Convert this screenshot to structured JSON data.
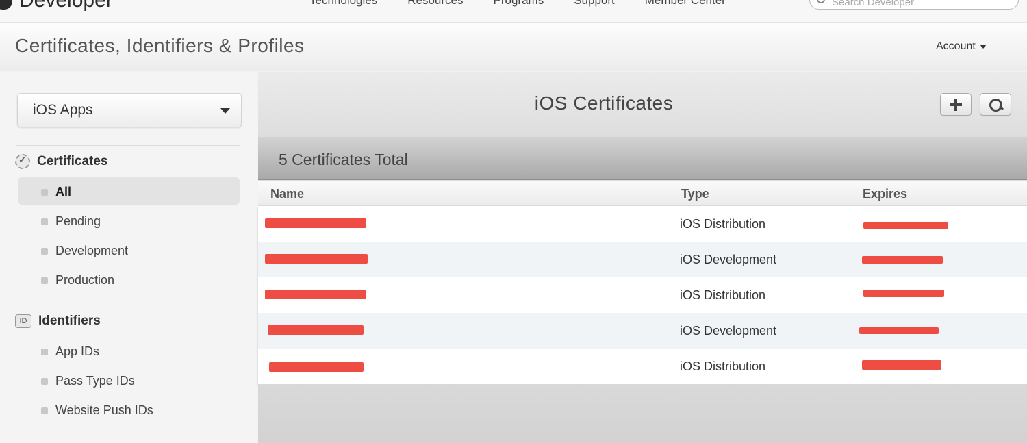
{
  "global_nav": {
    "brand": "Developer",
    "links": [
      "Technologies",
      "Resources",
      "Programs",
      "Support",
      "Member Center"
    ],
    "search_placeholder": "Search Developer"
  },
  "header": {
    "title": "Certificates, Identifiers & Profiles",
    "account_label": "Account"
  },
  "sidebar": {
    "platform_select": "iOS Apps",
    "certificates": {
      "heading": "Certificates",
      "items": [
        "All",
        "Pending",
        "Development",
        "Production"
      ],
      "active": "All"
    },
    "identifiers": {
      "heading": "Identifiers",
      "icon_text": "ID",
      "items": [
        "App IDs",
        "Pass Type IDs",
        "Website Push IDs"
      ]
    }
  },
  "main": {
    "title": "iOS Certificates",
    "count_text": "5 Certificates Total",
    "columns": [
      "Name",
      "Type",
      "Expires"
    ],
    "rows": [
      {
        "type": "iOS Distribution"
      },
      {
        "type": "iOS Development"
      },
      {
        "type": "iOS Distribution"
      },
      {
        "type": "iOS Development"
      },
      {
        "type": "iOS Distribution"
      }
    ]
  },
  "colors": {
    "redaction": "#ee4d44",
    "row_alt": "#f1f4f7"
  }
}
